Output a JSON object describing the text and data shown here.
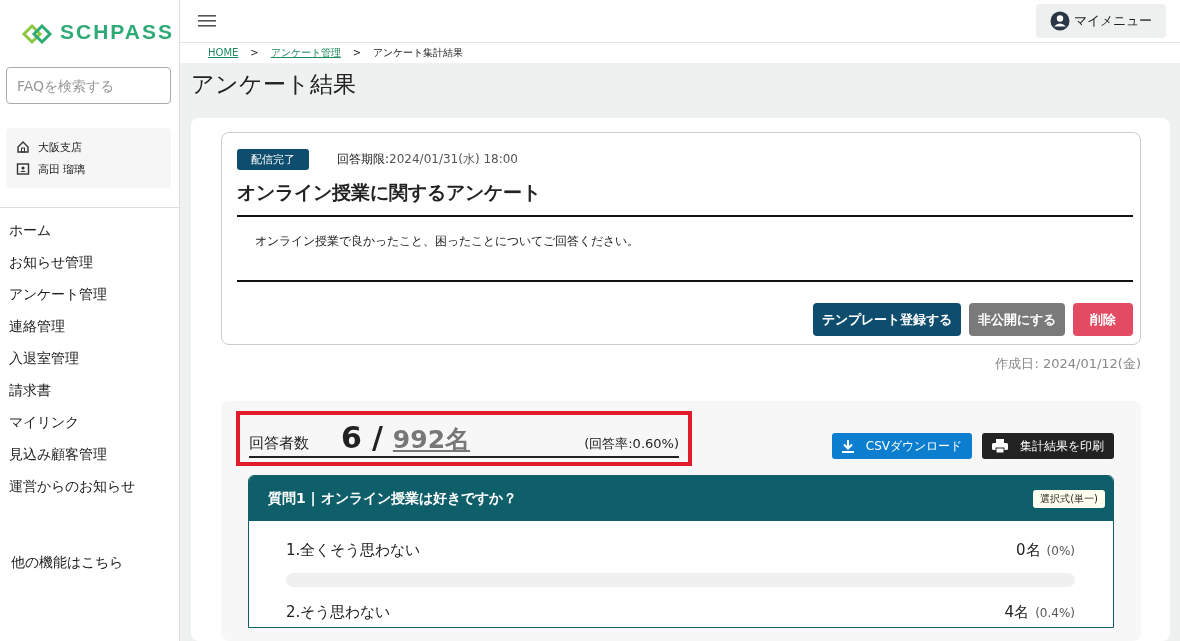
{
  "sidebar": {
    "logo": "SCHPASS",
    "search": {
      "placeholder": "FAQを検索する"
    },
    "account": [
      {
        "kind": "home",
        "text": "大阪支店"
      },
      {
        "kind": "person",
        "text": "高田 瑠璃"
      }
    ],
    "nav": [
      {
        "label": "ホーム"
      },
      {
        "label": "お知らせ管理"
      },
      {
        "label": "アンケート管理"
      },
      {
        "label": "連絡管理"
      },
      {
        "label": "入退室管理"
      },
      {
        "label": "請求書"
      },
      {
        "label": "マイリンク"
      },
      {
        "label": "見込み顧客管理"
      },
      {
        "label": "運営からのお知らせ"
      }
    ],
    "other_link": "他の機能はこちら"
  },
  "topbar": {
    "my_menu": "マイメニュー"
  },
  "breadcrumb": [
    {
      "label": "HOME",
      "link": true
    },
    {
      "label": "アンケート管理",
      "link": true
    },
    {
      "label": "アンケート集計結果",
      "link": false
    }
  ],
  "breadcrumb_separator": ">",
  "page_title": "アンケート結果",
  "survey": {
    "status": "配信完了",
    "deadline_label": "回答期限:",
    "deadline": "2024/01/31(水) 18:00",
    "title": "オンライン授業に関するアンケート",
    "description": "オンライン授業で良かったこと、困ったことについてご回答ください。",
    "buttons": [
      {
        "kind": "primary",
        "label": "テンプレート登録する"
      },
      {
        "kind": "muted",
        "label": "非公開にする"
      },
      {
        "kind": "danger",
        "label": "削除"
      }
    ],
    "created_label": "作成日:",
    "created": "2024/01/12(金)"
  },
  "summary": {
    "label": "回答者数",
    "answered": "6",
    "slash": "/",
    "total": "992名",
    "rate": "(回答率:0.60%)",
    "highlighted": true
  },
  "actions": [
    {
      "kind": "download",
      "label": "CSVダウンロード"
    },
    {
      "kind": "print",
      "label": "集計結果を印刷"
    }
  ],
  "question": {
    "title": "質問1 | オンライン授業は好きですか？",
    "type": "選択式(単一)",
    "options": [
      {
        "label": "1.全くそう思わない",
        "count": "0名",
        "percent": "(0%)",
        "level": 0
      },
      {
        "label": "2.そう思わない",
        "count": "4名",
        "percent": "(0.4%)"
      }
    ]
  }
}
